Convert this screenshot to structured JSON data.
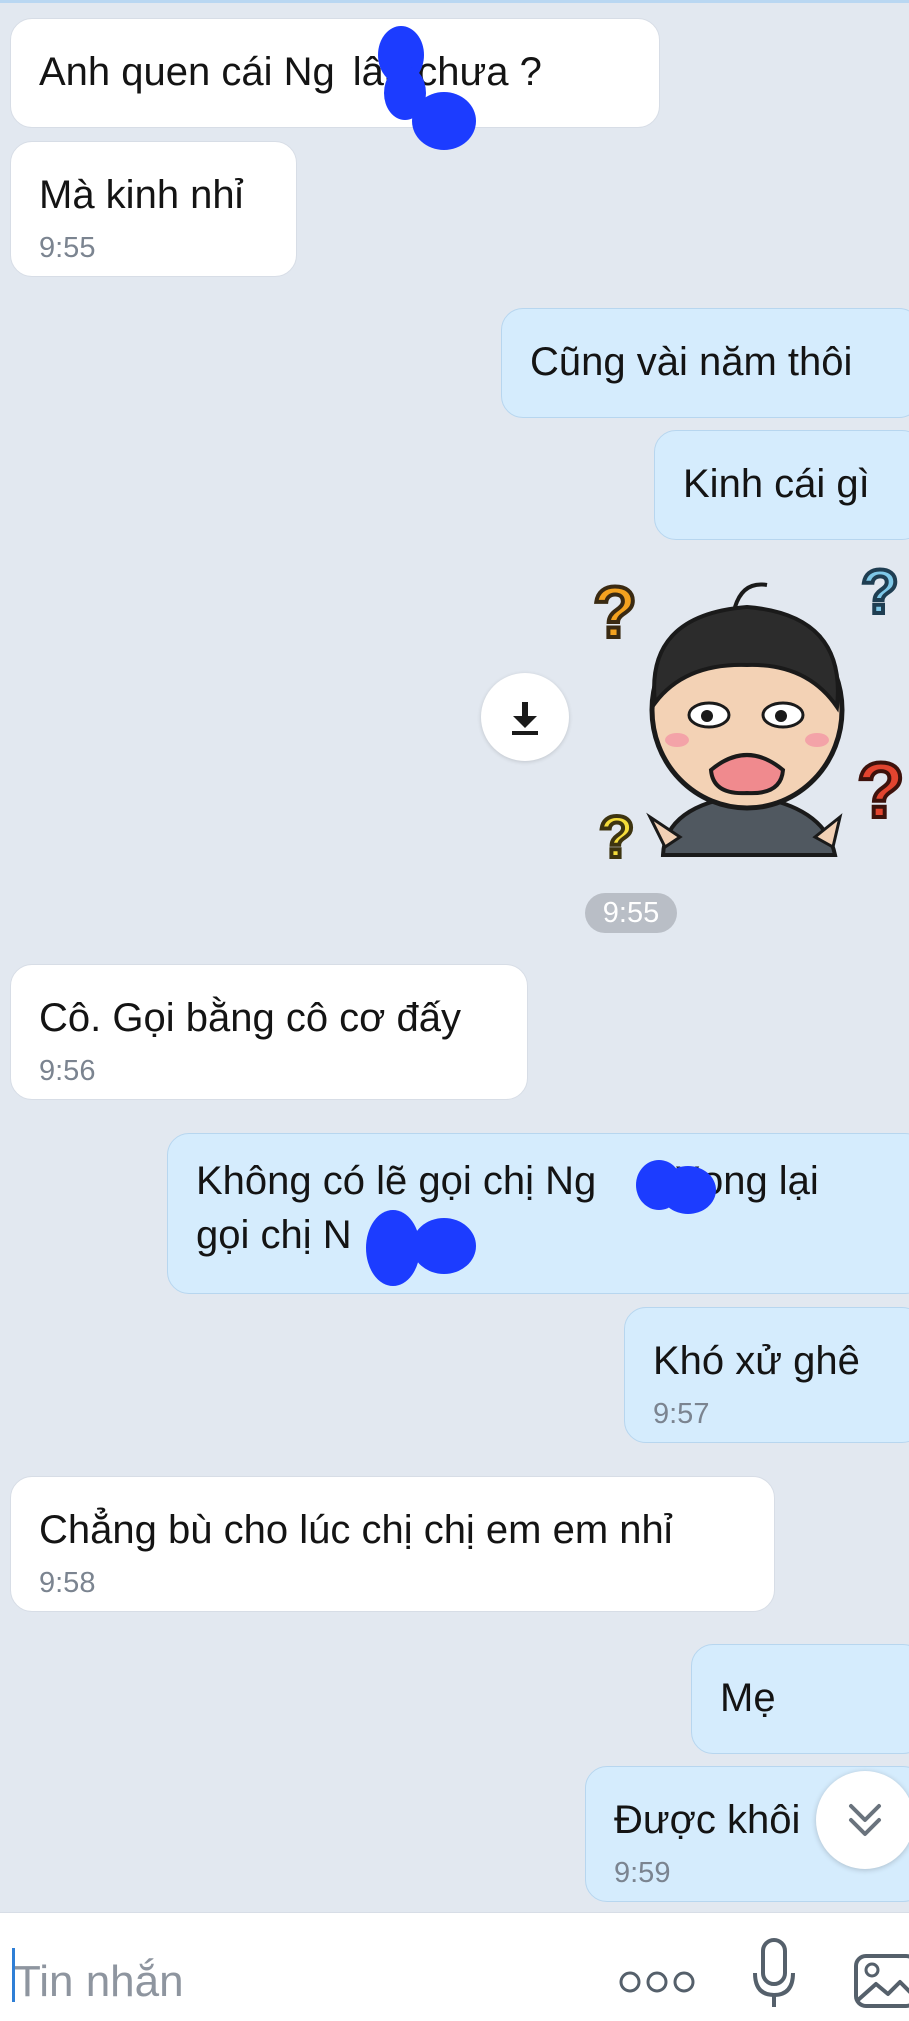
{
  "messages": [
    {
      "side": "in",
      "parts": [
        "Anh quen cái Ng",
        "lâu chưa ?"
      ],
      "time": ""
    },
    {
      "side": "in",
      "text": "Mà kinh nhỉ",
      "time": "9:55"
    },
    {
      "side": "out",
      "text": "Cũng vài năm thôi",
      "time": ""
    },
    {
      "side": "out",
      "text": "Kinh cái gì",
      "time": ""
    },
    {
      "side": "in",
      "text": "Cô. Gọi bằng cô cơ đấy",
      "time": "9:56"
    },
    {
      "side": "out",
      "parts": [
        "Không có lẽ gọi chị Ng",
        "Xong lại",
        "gọi chị N"
      ],
      "time": ""
    },
    {
      "side": "out",
      "text": "Khó xử ghê",
      "time": "9:57"
    },
    {
      "side": "in",
      "text": "Chẳng bù cho lúc chị chị em em nhỉ",
      "time": "9:58"
    },
    {
      "side": "out",
      "text": "Mẹ",
      "time": ""
    },
    {
      "side": "out",
      "text": "Được khôi",
      "time": "9:59"
    }
  ],
  "sticker": {
    "name": "confused-boy-sticker",
    "time": "9:55",
    "question_mark": "?"
  },
  "icons": {
    "download": "download-icon",
    "scroll": "double-chevron-down-icon",
    "more": "more-dots-icon",
    "mic": "microphone-icon",
    "image": "image-icon"
  },
  "composer": {
    "placeholder": "Tin nhắn"
  },
  "colors": {
    "background": "#e2e8f0",
    "incoming_bubble": "#ffffff",
    "outgoing_bubble": "#d5ecfd",
    "redaction": "#1c3cff",
    "accent": "#2f7fd6"
  }
}
